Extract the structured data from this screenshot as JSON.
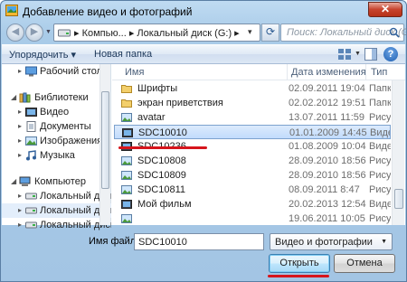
{
  "window": {
    "title": "Добавление видео и фотографий",
    "close_label": "✕"
  },
  "address_bar": {
    "path": "▸ Компью... ▸ Локальный диск (G:) ▸",
    "search_placeholder": "Поиск: Локальный диск (G:)"
  },
  "toolbar": {
    "organize_label": "Упорядочить ▾",
    "new_folder_label": "Новая папка",
    "help_label": "?"
  },
  "nav_pane": {
    "items": [
      {
        "label": "Рабочий стол",
        "icon": "desktop-icon"
      },
      {
        "label": "Библиотеки",
        "icon": "library-icon"
      },
      {
        "label": "Видео",
        "icon": "video-library-icon"
      },
      {
        "label": "Документы",
        "icon": "documents-library-icon"
      },
      {
        "label": "Изображения",
        "icon": "pictures-library-icon"
      },
      {
        "label": "Музыка",
        "icon": "music-library-icon"
      },
      {
        "label": "Компьютер",
        "icon": "computer-icon"
      },
      {
        "label": "Локальный диск",
        "icon": "drive-icon"
      },
      {
        "label": "Локальный диск",
        "icon": "drive-icon"
      },
      {
        "label": "Локальный диск",
        "icon": "drive-icon"
      }
    ]
  },
  "file_list": {
    "columns": {
      "name": "Имя",
      "date": "Дата изменения",
      "type": "Тип"
    },
    "rows": [
      {
        "name": "Шрифты",
        "date": "02.09.2011 19:04",
        "type": "Папка",
        "icon": "folder-icon"
      },
      {
        "name": "экран приветствия",
        "date": "02.02.2012 19:51",
        "type": "Папка",
        "icon": "folder-icon"
      },
      {
        "name": "avatar",
        "date": "13.07.2011 11:59",
        "type": "Рисун",
        "icon": "image-file-icon"
      },
      {
        "name": "SDC10010",
        "date": "01.01.2009 14:45",
        "type": "Видео",
        "icon": "video-file-icon"
      },
      {
        "name": "SDC10236",
        "date": "01.08.2009 10:04",
        "type": "Видео",
        "icon": "video-file-icon"
      },
      {
        "name": "SDC10808",
        "date": "28.09.2010 18:56",
        "type": "Рисун",
        "icon": "image-file-icon"
      },
      {
        "name": "SDC10809",
        "date": "28.09.2010 18:56",
        "type": "Рисун",
        "icon": "image-file-icon"
      },
      {
        "name": "SDC10811",
        "date": "08.09.2011 8:47",
        "type": "Рисун",
        "icon": "image-file-icon"
      },
      {
        "name": "Мой фильм",
        "date": "20.02.2013 12:54",
        "type": "Видео",
        "icon": "video-file-icon"
      },
      {
        "name": "",
        "date": "19.06.2011 10:05",
        "type": "Рисун",
        "icon": "image-file-icon"
      }
    ]
  },
  "bottom": {
    "filename_label": "Имя файла:",
    "filename_value": "SDC10010",
    "filter_value": "Видео и фотографии",
    "open_label": "Открыть",
    "cancel_label": "Отмена"
  },
  "colors": {
    "accent_red": "#d6151c",
    "selection": "#c1dbfc"
  }
}
